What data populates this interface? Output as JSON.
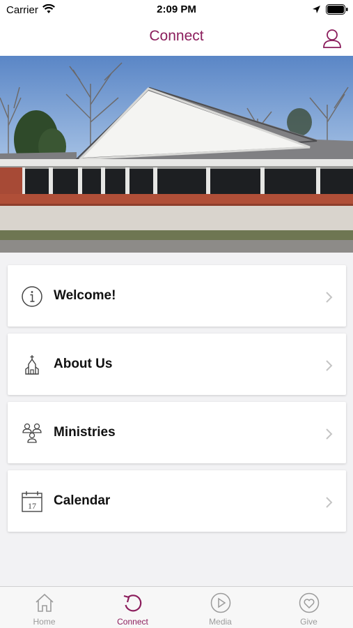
{
  "status_bar": {
    "carrier": "Carrier",
    "time": "2:09 PM"
  },
  "nav": {
    "title": "Connect",
    "profile_icon": "person-icon"
  },
  "colors": {
    "accent": "#8b1d5c",
    "inactive": "#9b9b9b",
    "card_bg": "#ffffff",
    "page_bg": "#f2f2f4"
  },
  "menu": [
    {
      "label": "Welcome!",
      "icon": "info-icon"
    },
    {
      "label": "About Us",
      "icon": "church-icon"
    },
    {
      "label": "Ministries",
      "icon": "people-group-icon"
    },
    {
      "label": "Calendar",
      "icon": "calendar-icon",
      "icon_text": "17"
    }
  ],
  "tabs": [
    {
      "label": "Home",
      "icon": "home-icon",
      "active": false
    },
    {
      "label": "Connect",
      "icon": "connect-icon",
      "active": true
    },
    {
      "label": "Media",
      "icon": "play-icon",
      "active": false
    },
    {
      "label": "Give",
      "icon": "heart-icon",
      "active": false
    }
  ]
}
